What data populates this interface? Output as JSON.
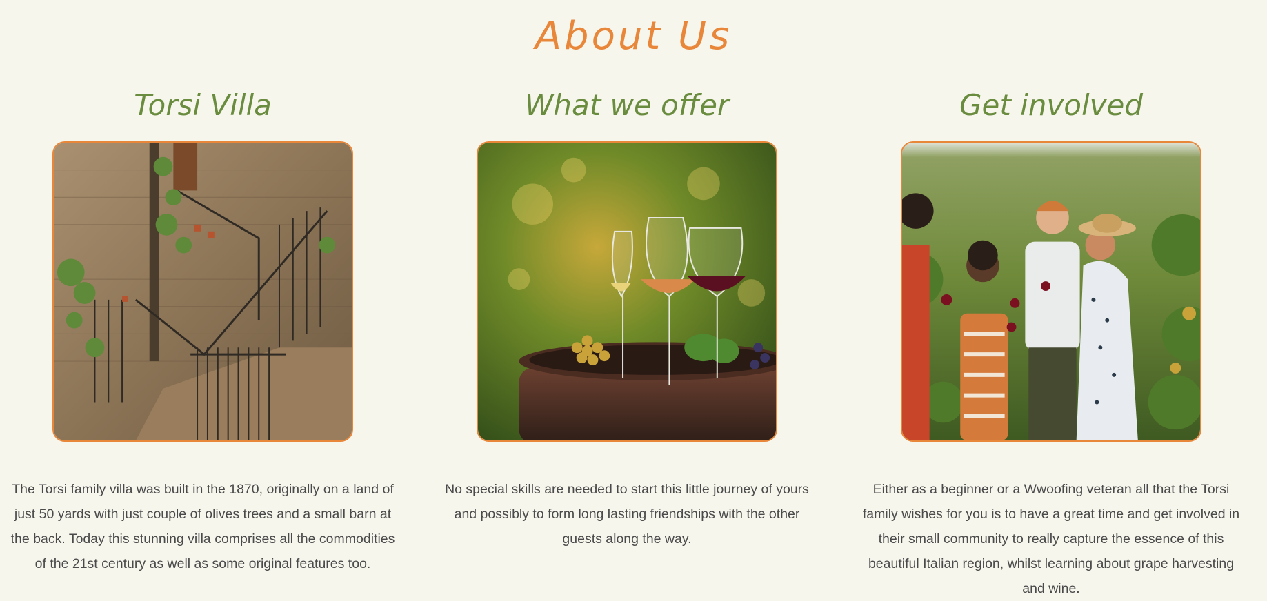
{
  "section": {
    "title": "About Us"
  },
  "columns": [
    {
      "heading": "Torsi Villa",
      "image": "stone-villa-staircase-photo",
      "text": "The Torsi family villa was built in the 1870, originally on a land of just 50 yards with just couple of olives trees and a small barn at the back. Today this stunning villa comprises all the commodities of the 21st century as well as some original features too."
    },
    {
      "heading": "What we offer",
      "image": "wine-glasses-on-barrel-photo",
      "text": "No special skills are needed to start this little journey of yours and possibly to form long lasting friendships with the other guests along the way."
    },
    {
      "heading": "Get involved",
      "image": "friends-in-vineyard-photo",
      "text": "Either as a beginner or a Wwoofing veteran all that the Torsi family wishes for you is to have a great time and get involved in their small community to really capture the essence of this beautiful Italian region, whilst learning about grape harvesting and wine."
    }
  ],
  "colors": {
    "accent": "#e8873a",
    "heading": "#6a8c3f",
    "background": "#f7f6ed",
    "text": "#4a4a4a"
  }
}
